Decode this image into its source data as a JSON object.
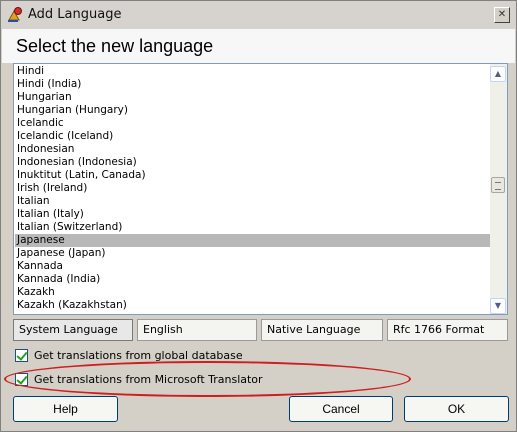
{
  "window": {
    "title": "Add Language",
    "close_label": "✕"
  },
  "header": {
    "heading": "Select the new language"
  },
  "languages": {
    "items": [
      "Hindi",
      "Hindi (India)",
      "Hungarian",
      "Hungarian (Hungary)",
      "Icelandic",
      "Icelandic (Iceland)",
      "Indonesian",
      "Indonesian (Indonesia)",
      "Inuktitut (Latin, Canada)",
      "Irish (Ireland)",
      "Italian",
      "Italian (Italy)",
      "Italian (Switzerland)",
      "Japanese",
      "Japanese (Japan)",
      "Kannada",
      "Kannada (India)",
      "Kazakh",
      "Kazakh (Kazakhstan)"
    ],
    "selected": "Japanese",
    "scroll_up": "▲",
    "scroll_down": "▼"
  },
  "tabs": [
    {
      "label": "System Language",
      "active": true
    },
    {
      "label": "English",
      "active": false
    },
    {
      "label": "Native Language",
      "active": false
    },
    {
      "label": "Rfc 1766 Format",
      "active": false
    }
  ],
  "options": {
    "global_db": {
      "label": "Get translations from global database",
      "checked": true
    },
    "ms_translator": {
      "label": "Get translations from Microsoft Translator",
      "checked": true
    }
  },
  "buttons": {
    "help": "Help",
    "cancel": "Cancel",
    "ok": "OK"
  },
  "colors": {
    "annotation": "#cc1f1f",
    "selection": "#b8b8b8",
    "check": "#21a121"
  }
}
